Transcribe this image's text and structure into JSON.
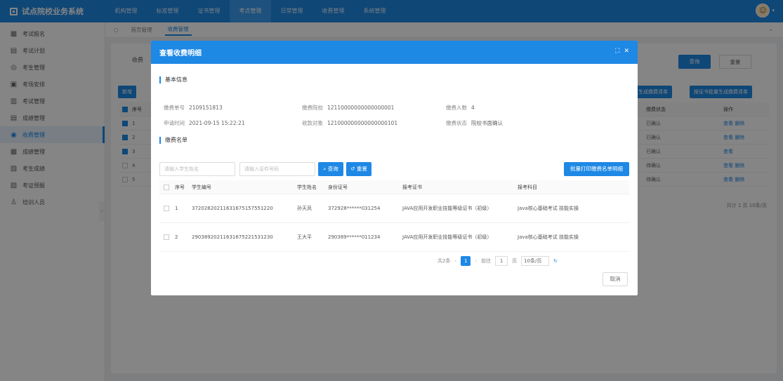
{
  "app": {
    "title": "试点院校业务系统"
  },
  "topnav": [
    "机构管理",
    "标准管理",
    "证书管理",
    "考点管理",
    "日常管理",
    "收费管理",
    "系统管理"
  ],
  "topnav_active": 3,
  "user": {
    "avatar_icon": "user-avatar-icon"
  },
  "sidebar": [
    {
      "label": "考试报名",
      "icon": "calendar-icon"
    },
    {
      "label": "考试计划",
      "icon": "plan-icon"
    },
    {
      "label": "考生管理",
      "icon": "user-icon"
    },
    {
      "label": "考场安排",
      "icon": "room-icon"
    },
    {
      "label": "考试管理",
      "icon": "grid-icon"
    },
    {
      "label": "成绩管理",
      "icon": "doc-icon"
    },
    {
      "label": "收费管理",
      "icon": "money-icon"
    },
    {
      "label": "成绩管理",
      "icon": "chart-icon"
    },
    {
      "label": "考生成绩",
      "icon": "score-icon"
    },
    {
      "label": "考证预报",
      "icon": "report-icon"
    },
    {
      "label": "培训人员",
      "icon": "people-icon"
    }
  ],
  "sidebar_active": 6,
  "tabs": [
    "首页管理",
    "收费管理"
  ],
  "tabs_active": 1,
  "bg": {
    "search_label": "收费",
    "btn_query": "查询",
    "btn_reset": "重置",
    "btn_new": "新增",
    "btn_gen_list": "生成缴费清单",
    "btn_gen_cert": "按证书批量生成缴费清单",
    "col_idx": "序号",
    "col_status": "缴费状态",
    "col_op": "操作",
    "rows": [
      {
        "idx": "1",
        "status": "已确认",
        "op": "查看 删除"
      },
      {
        "idx": "2",
        "status": "已确认",
        "op": "查看 删除"
      },
      {
        "idx": "3",
        "status": "已确认",
        "op": "查看"
      },
      {
        "idx": "4",
        "status": "待确认",
        "op": "查看 删除"
      },
      {
        "idx": "5",
        "status": "待确认",
        "op": "查看 删除"
      }
    ],
    "pager": "共计 1 页 10条/页"
  },
  "modal": {
    "title": "查看收费明细",
    "section_basic": "基本信息",
    "section_list": "缴费名单",
    "info": {
      "order_no_label": "缴费单号",
      "order_no": "2109151813",
      "school_label": "缴费院校",
      "school": "12110000000000000001",
      "count_label": "缴费人数",
      "count": "4",
      "apply_time_label": "申请时间",
      "apply_time": "2021-09-15 15:22:21",
      "target_label": "收款对象",
      "target": "121000000000000000101",
      "status_label": "缴费状态",
      "status": "院校书面确认"
    },
    "search": {
      "name_placeholder": "请输入学生姓名",
      "id_placeholder": "请输入证件号码",
      "btn_query": "查询",
      "btn_reset": "重置",
      "btn_export": "批量打印缴费名单明细"
    },
    "table": {
      "headers": [
        "序号",
        "学生编号",
        "学生姓名",
        "身份证号",
        "报考证书",
        "报考科目"
      ],
      "rows": [
        {
          "idx": "1",
          "student_no": "37202820211631675157551220",
          "name": "孙天凤",
          "id_no": "372928******031254",
          "cert": "JAVA应用开发职业技能等级证书（初级）",
          "subjects": "Java核心基础考试 技能实操"
        },
        {
          "idx": "2",
          "student_no": "29038920211631675221531230",
          "name": "王大平",
          "id_no": "290389******011234",
          "cert": "JAVA应用开发职业技能等级证书（初级）",
          "subjects": "Java核心基础考试 技能实操"
        }
      ]
    },
    "pager": {
      "total": "共2条",
      "page": "1",
      "goto_label": "前往",
      "goto_value": "1",
      "goto_unit": "页",
      "size": "10条/页"
    },
    "close": "取消"
  }
}
